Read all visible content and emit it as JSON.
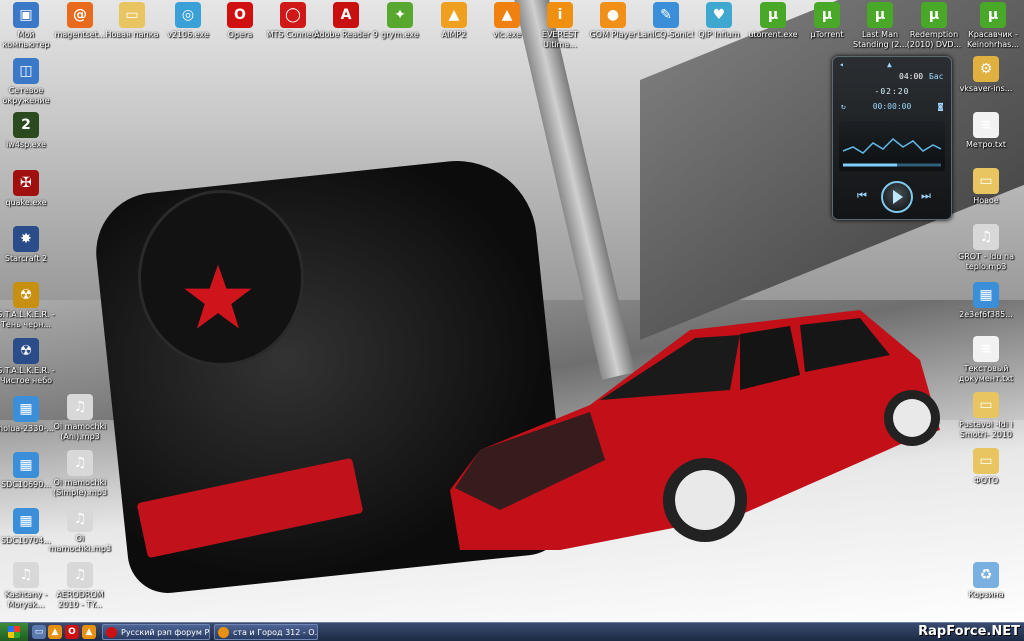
{
  "desktop": {
    "top_row": [
      {
        "label": "Мой компьютер",
        "icon": "my-computer-icon",
        "glyph": "▣",
        "color": "#3c78c8"
      },
      {
        "label": "magentset...",
        "icon": "magent-icon",
        "glyph": "@",
        "color": "#e86a1c"
      },
      {
        "label": "Новая папка",
        "icon": "folder-icon",
        "glyph": "▭",
        "color": "#e8c560"
      },
      {
        "label": "v2106.exe",
        "icon": "disc-icon",
        "glyph": "◎",
        "color": "#3aa0d8"
      },
      {
        "label": "Opera",
        "icon": "opera-icon",
        "glyph": "O",
        "color": "#d01010"
      },
      {
        "label": "MTS Connect",
        "icon": "mts-icon",
        "glyph": "◯",
        "color": "#d01818"
      },
      {
        "label": "Adobe Reader 9",
        "icon": "adobe-reader-icon",
        "glyph": "A",
        "color": "#c81010"
      },
      {
        "label": "grym.exe",
        "icon": "grym-icon",
        "glyph": "✦",
        "color": "#58a830"
      },
      {
        "label": "AIMP2",
        "icon": "aimp-icon",
        "glyph": "▲",
        "color": "#f0a020"
      },
      {
        "label": "vlc.exe",
        "icon": "vlc-icon",
        "glyph": "▲",
        "color": "#f08010"
      },
      {
        "label": "EVEREST Ultima...",
        "icon": "everest-icon",
        "glyph": "i",
        "color": "#f09010"
      },
      {
        "label": "GOM Player",
        "icon": "gom-player-icon",
        "glyph": "●",
        "color": "#f09018"
      },
      {
        "label": "LanICQ-Sonic!",
        "icon": "lanicq-icon",
        "glyph": "✎",
        "color": "#3a8fd8"
      },
      {
        "label": "QIP Infium",
        "icon": "qip-icon",
        "glyph": "♥",
        "color": "#40a8d0"
      },
      {
        "label": "utorrent.exe",
        "icon": "utorrent-icon",
        "glyph": "μ",
        "color": "#4aa828"
      },
      {
        "label": "µTorrent",
        "icon": "utorrent-icon",
        "glyph": "μ",
        "color": "#4aa828"
      },
      {
        "label": "Last Man Standing (2...",
        "icon": "utorrent-icon",
        "glyph": "μ",
        "color": "#4aa828"
      },
      {
        "label": "Redemption (2010) DVD...",
        "icon": "utorrent-icon",
        "glyph": "μ",
        "color": "#4aa828"
      },
      {
        "label": "Красавчик - Keinohrhas...",
        "icon": "utorrent-icon",
        "glyph": "μ",
        "color": "#4aa828"
      }
    ],
    "left_column": [
      {
        "label": "Сетевое окружение",
        "icon": "network-icon",
        "glyph": "◫",
        "color": "#3c78c8"
      },
      {
        "label": "iw4sp.exe",
        "icon": "mw2-icon",
        "glyph": "2",
        "color": "#2c4a20"
      },
      {
        "label": "quake.exe",
        "icon": "quake-icon",
        "glyph": "✠",
        "color": "#a01010"
      },
      {
        "label": "Starcraft 2",
        "icon": "starcraft-icon",
        "glyph": "✸",
        "color": "#2a4c88"
      },
      {
        "label": "S.T.A.L.K.E.R. - Тень черн...",
        "icon": "stalker-icon",
        "glyph": "☢",
        "color": "#c89010"
      },
      {
        "label": "S.T.A.L.K.E.R. - Чистое небо",
        "icon": "stalker-icon",
        "glyph": "☢",
        "color": "#2a4c88"
      },
      {
        "label": "nolua-2330-...",
        "icon": "image-file-icon",
        "glyph": "▦",
        "color": "#3a8fd8"
      },
      {
        "label": "SDC10690...",
        "icon": "image-file-icon",
        "glyph": "▦",
        "color": "#3a8fd8"
      },
      {
        "label": "SDC10704...",
        "icon": "image-file-icon",
        "glyph": "▦",
        "color": "#3a8fd8"
      },
      {
        "label": "Kashtany - Moryak...",
        "icon": "mp3-file-icon",
        "glyph": "♫",
        "color": "#d8d8d8"
      }
    ],
    "second_column": [
      {
        "label": "Oi mamochki (Ani).mp3",
        "icon": "mp3-file-icon",
        "glyph": "♫",
        "color": "#d8d8d8"
      },
      {
        "label": "Oi mamochki (Simple).mp3",
        "icon": "mp3-file-icon",
        "glyph": "♫",
        "color": "#d8d8d8"
      },
      {
        "label": "Oi mamochki.mp3",
        "icon": "mp3-file-icon",
        "glyph": "♫",
        "color": "#d8d8d8"
      },
      {
        "label": "AERODROM 2010 - TY...",
        "icon": "mp3-file-icon",
        "glyph": "♫",
        "color": "#d8d8d8"
      }
    ],
    "right_column": [
      {
        "label": "vksaver-ins...",
        "icon": "installer-icon",
        "glyph": "⚙",
        "color": "#e0b040"
      },
      {
        "label": "Метро.txt",
        "icon": "text-file-icon",
        "glyph": "≡",
        "color": "#f2f2f2"
      },
      {
        "label": "Новое",
        "icon": "folder-icon",
        "glyph": "▭",
        "color": "#e8c560"
      },
      {
        "label": "GROT - Idu na teplo.mp3",
        "icon": "mp3-file-icon",
        "glyph": "♫",
        "color": "#d8d8d8"
      },
      {
        "label": "2e3ef6f385...",
        "icon": "image-file-icon",
        "glyph": "▦",
        "color": "#3a8fd8"
      },
      {
        "label": "Текстовый документ.txt",
        "icon": "text-file-icon",
        "glyph": "≡",
        "color": "#f2f2f2"
      },
      {
        "label": "Pustavoi -Idi i Smotri- 2010",
        "icon": "folder-icon",
        "glyph": "▭",
        "color": "#e8c560"
      },
      {
        "label": "ФОТО",
        "icon": "folder-icon",
        "glyph": "▭",
        "color": "#e8c560"
      },
      {
        "label": "Корзина",
        "icon": "recycle-bin-icon",
        "glyph": "♻",
        "color": "#7ab0e0"
      }
    ]
  },
  "player": {
    "clock": "04:00",
    "mode": "Бас",
    "elapsed": "-02:20",
    "counter": "00:00:00",
    "accent": "#9fd8ff"
  },
  "taskbar": {
    "quick_launch": [
      {
        "icon": "show-desktop-icon",
        "glyph": "▭",
        "color": "#5a7ab0"
      },
      {
        "icon": "aimp-icon",
        "glyph": "▲",
        "color": "#e89010"
      },
      {
        "icon": "opera-icon",
        "glyph": "O",
        "color": "#d01010"
      },
      {
        "icon": "aimp-icon",
        "glyph": "▲",
        "color": "#e89010"
      }
    ],
    "tasks": [
      {
        "label": "Русский рэп форум Р...",
        "icon": "opera-icon",
        "color": "#d01010"
      },
      {
        "label": "ста и Город 312 - О...",
        "icon": "aimp-icon",
        "color": "#e89010"
      }
    ],
    "watermark": "RapForce.NET"
  }
}
